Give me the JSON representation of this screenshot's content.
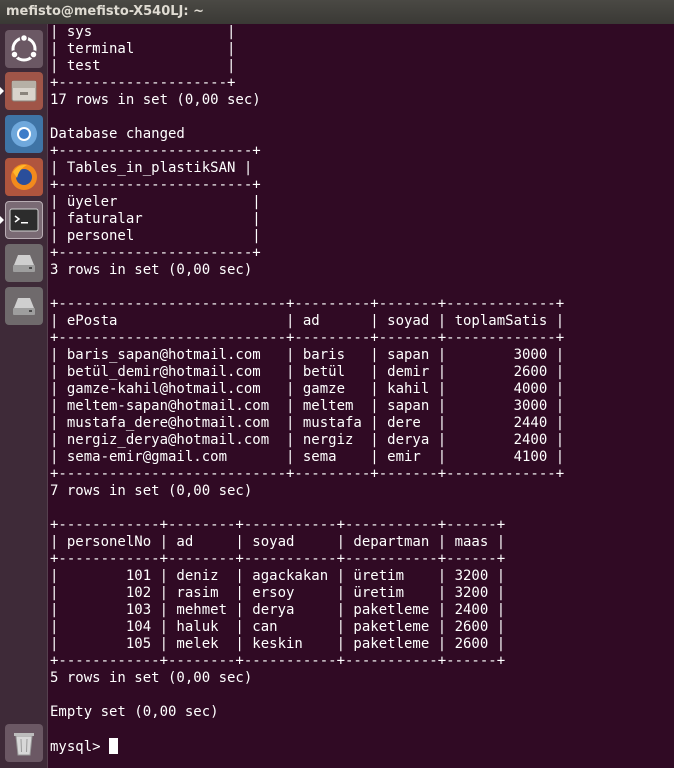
{
  "window": {
    "title": "mefisto@mefisto-X540LJ: ~"
  },
  "launcher": {
    "items": [
      {
        "name": "dash-icon"
      },
      {
        "name": "files-icon"
      },
      {
        "name": "chromium-icon"
      },
      {
        "name": "firefox-icon"
      },
      {
        "name": "terminal-icon"
      },
      {
        "name": "drive-icon"
      },
      {
        "name": "drive-icon"
      },
      {
        "name": "trash-icon"
      }
    ]
  },
  "terminal": {
    "lines": [
      "| sys                |",
      "| terminal           |",
      "| test               |",
      "+--------------------+",
      "17 rows in set (0,00 sec)",
      "",
      "Database changed",
      "+-----------------------+",
      "| Tables_in_plastikSAN |",
      "+-----------------------+",
      "| üyeler                |",
      "| faturalar             |",
      "| personel              |",
      "+-----------------------+",
      "3 rows in set (0,00 sec)",
      "",
      "+---------------------------+---------+-------+-------------+",
      "| ePosta                    | ad      | soyad | toplamSatis |",
      "+---------------------------+---------+-------+-------------+",
      "| baris_sapan@hotmail.com   | baris   | sapan |        3000 |",
      "| betül_demir@hotmail.com   | betül   | demir |        2600 |",
      "| gamze-kahil@hotmail.com   | gamze   | kahil |        4000 |",
      "| meltem-sapan@hotmail.com  | meltem  | sapan |        3000 |",
      "| mustafa_dere@hotmail.com  | mustafa | dere  |        2440 |",
      "| nergiz_derya@hotmail.com  | nergiz  | derya |        2400 |",
      "| sema-emir@gmail.com       | sema    | emir  |        4100 |",
      "+---------------------------+---------+-------+-------------+",
      "7 rows in set (0,00 sec)",
      "",
      "+------------+--------+-----------+-----------+------+",
      "| personelNo | ad     | soyad     | departman | maas |",
      "+------------+--------+-----------+-----------+------+",
      "|        101 | deniz  | agackakan | üretim    | 3200 |",
      "|        102 | rasim  | ersoy     | üretim    | 3200 |",
      "|        103 | mehmet | derya     | paketleme | 2400 |",
      "|        104 | haluk  | can       | paketleme | 2600 |",
      "|        105 | melek  | keskin    | paketleme | 2600 |",
      "+------------+--------+-----------+-----------+------+",
      "5 rows in set (0,00 sec)",
      "",
      "Empty set (0,00 sec)",
      ""
    ],
    "prompt": "mysql> "
  }
}
